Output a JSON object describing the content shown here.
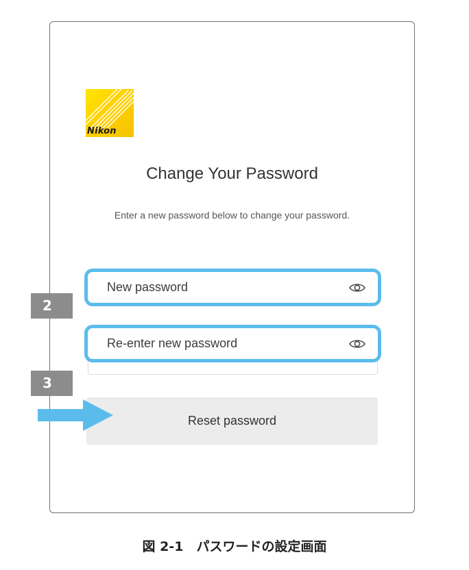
{
  "logo": {
    "brand": "Nikon",
    "icon": "nikon-logo"
  },
  "form": {
    "title": "Change Your Password",
    "subtitle": "Enter a new password below to change your password.",
    "new_password": {
      "value": "",
      "placeholder": "New password",
      "icon": "eye-icon"
    },
    "confirm_password": {
      "value": "",
      "placeholder": "Re-enter new password",
      "icon": "eye-icon"
    },
    "reset_button_label": "Reset password"
  },
  "annotations": {
    "step2_label": "2",
    "step3_label": "3",
    "highlight_color": "#5bbcec",
    "badge_color": "#8c8c8c",
    "arrow_color": "#5bbcec"
  },
  "caption": "図 2-1　パスワードの設定画面"
}
